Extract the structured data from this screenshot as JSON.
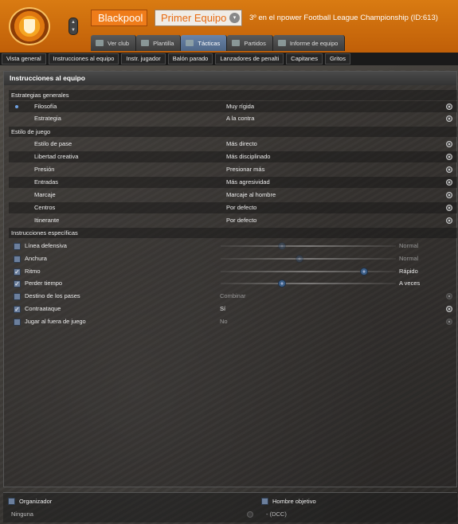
{
  "header": {
    "club_name": "Blackpool",
    "team_selector": "Primer Equipo",
    "league_info": "3º en el npower Football League Championship (ID:613)",
    "nav_tabs": [
      {
        "label": "Ver club",
        "icon": "club-icon"
      },
      {
        "label": "Plantilla",
        "icon": "squad-icon"
      },
      {
        "label": "Tácticas",
        "icon": "tactics-icon"
      },
      {
        "label": "Partidos",
        "icon": "calendar-icon"
      },
      {
        "label": "Informe de equipo",
        "icon": "report-icon"
      }
    ],
    "active_tab": "Tácticas"
  },
  "subnav": [
    "Vista general",
    "Instrucciones al equipo",
    "Instr. jugador",
    "Balón parado",
    "Lanzadores de penalti",
    "Capitanes",
    "Gritos"
  ],
  "panel": {
    "title": "Instrucciones al equipo",
    "general_section": "Estrategias generales",
    "general": [
      {
        "label": "Filosofía",
        "value": "Muy rígida"
      },
      {
        "label": "Estrategia",
        "value": "A la contra"
      }
    ],
    "style_section": "Estilo de juego",
    "style": [
      {
        "label": "Estilo de pase",
        "value": "Más directo"
      },
      {
        "label": "Libertad creativa",
        "value": "Más disciplinado"
      },
      {
        "label": "Presión",
        "value": "Presionar más"
      },
      {
        "label": "Entradas",
        "value": "Más agresividad"
      },
      {
        "label": "Marcaje",
        "value": "Marcaje al hombre"
      },
      {
        "label": "Centros",
        "value": "Por defecto"
      },
      {
        "label": "Itinerante",
        "value": "Por defecto"
      }
    ],
    "specific_section": "Instrucciones específicas",
    "specific_sliders": [
      {
        "label": "Línea defensiva",
        "checked": false,
        "value_text": "Normal",
        "level": 0.35
      },
      {
        "label": "Anchura",
        "checked": false,
        "value_text": "Normal",
        "level": 0.45
      },
      {
        "label": "Ritmo",
        "checked": true,
        "value_text": "Rápido",
        "level": 0.82
      },
      {
        "label": "Perder tiempo",
        "checked": true,
        "value_text": "A veces",
        "level": 0.35
      }
    ],
    "specific_options": [
      {
        "label": "Destino de los pases",
        "checked": false,
        "value": "Combinar"
      },
      {
        "label": "Contraataque",
        "checked": true,
        "value": "Sí"
      },
      {
        "label": "Jugar al fuera de juego",
        "checked": false,
        "value": "No"
      }
    ]
  },
  "bottom": {
    "organizer_label": "Organizador",
    "organizer_value": "Ninguna",
    "target_label": "Hombre objetivo",
    "target_value": "- (DCC)"
  },
  "check_mark": "✓",
  "colors": {
    "header_orange": "#d97b12",
    "accent_blue": "#3b5e86"
  }
}
